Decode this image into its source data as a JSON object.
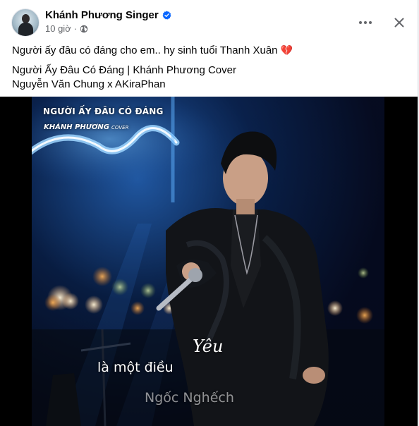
{
  "post": {
    "author_name": "Khánh Phương Singer",
    "timestamp": "10 giờ",
    "privacy_icon": "globe-icon",
    "verified_icon": "verified-badge-icon",
    "more_icon": "more-dots-icon",
    "close_icon": "close-icon",
    "text_line1": "Người ấy đâu có đáng cho em.. hy sinh tuổi Thanh Xuân",
    "text_line1_emoji": "💔",
    "text_line2": "Người Ấy Đâu Có Đáng | Khánh Phương Cover",
    "text_line3": "Nguyễn Văn Chung x AKiraPhan"
  },
  "video": {
    "overlay_title": "NGƯỜI ẤY ĐÂU CÓ ĐÁNG",
    "overlay_subtitle": "KHÁNH PHƯƠNG",
    "overlay_subtitle_tag": "COVER",
    "lyric_main": "là một điều",
    "lyric_script": "Yêu",
    "lyric_faded": "Ngốc Nghếch"
  },
  "colors": {
    "verified_blue": "#0866ff",
    "text_primary": "#050505",
    "text_secondary": "#65676b"
  }
}
